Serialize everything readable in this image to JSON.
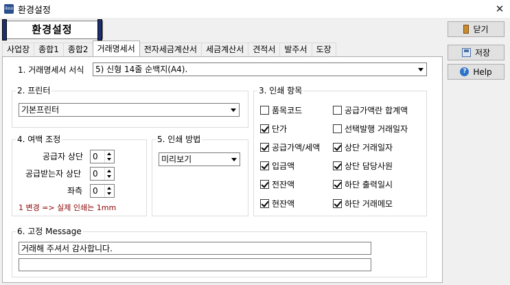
{
  "window": {
    "title": "환경설정",
    "close_glyph": "✕",
    "icon_text": "ikoo"
  },
  "banner": {
    "title": "환경설정"
  },
  "side_buttons": {
    "close_label": "닫기",
    "save_label": "저장",
    "help_label": "Help",
    "help_glyph": "?"
  },
  "tabs": [
    {
      "label": "사업장",
      "active": false
    },
    {
      "label": "종합1",
      "active": false
    },
    {
      "label": "종합2",
      "active": false
    },
    {
      "label": "거래명세서",
      "active": true
    },
    {
      "label": "전자세금계산서",
      "active": false
    },
    {
      "label": "세금계산서",
      "active": false
    },
    {
      "label": "견적서",
      "active": false
    },
    {
      "label": "발주서",
      "active": false
    },
    {
      "label": "도장",
      "active": false
    }
  ],
  "format": {
    "label": "1. 거래명세서 서식",
    "value": "5) 신형 14줄 순백지(A4)."
  },
  "printer": {
    "title": "2. 프린터",
    "value": "기본프린터"
  },
  "margin": {
    "title": "4. 여백 조정",
    "rows": [
      {
        "label": "공급자 상단",
        "value": "0"
      },
      {
        "label": "공급받는자 상단",
        "value": "0"
      },
      {
        "label": "좌측",
        "value": "0"
      }
    ],
    "note": "1 변경 => 실제 인쇄는 1mm"
  },
  "print_method": {
    "title": "5. 인쇄 방법",
    "value": "미리보기"
  },
  "print_items": {
    "title": "3. 인쇄 항목",
    "left": [
      {
        "label": "품목코드",
        "checked": false
      },
      {
        "label": "단가",
        "checked": true
      },
      {
        "label": "공급가액/세액",
        "checked": true
      },
      {
        "label": "입금액",
        "checked": true
      },
      {
        "label": "전잔액",
        "checked": true
      },
      {
        "label": "현잔액",
        "checked": true
      }
    ],
    "right": [
      {
        "label": "공급가액란 합계액",
        "checked": false
      },
      {
        "label": "선택발행 거래일자",
        "checked": false
      },
      {
        "label": "상단 거래일자",
        "checked": true
      },
      {
        "label": "상단 담당사원",
        "checked": true
      },
      {
        "label": "하단 출력일시",
        "checked": true
      },
      {
        "label": "하단 거래메모",
        "checked": true
      }
    ]
  },
  "fixed_message": {
    "title": "6. 고정 Message",
    "line1": "거래해 주셔서 감사합니다.",
    "line2": ""
  },
  "colors": {
    "banner_bar": "#1d2f6f",
    "note_text": "#8b0000",
    "help_icon": "#2e73c7"
  }
}
